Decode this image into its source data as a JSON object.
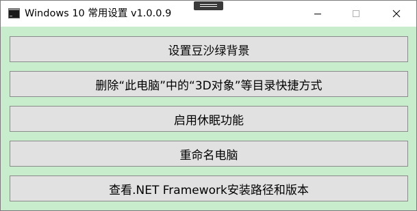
{
  "window": {
    "title": "Windows 10 常用设置 v1.0.0.9",
    "icon": "console-app-icon",
    "controls": {
      "minimize_icon": "minimize-icon",
      "maximize_icon": "maximize-icon",
      "close_icon": "close-icon"
    }
  },
  "colors": {
    "background": "#c7edcc",
    "button_face": "#e1e1e1",
    "button_border": "#8a8a8a"
  },
  "buttons": [
    {
      "label": "设置豆沙绿背景"
    },
    {
      "label": "删除“此电脑”中的“3D对象”等目录快捷方式"
    },
    {
      "label": "启用休眠功能"
    },
    {
      "label": "重命名电脑"
    },
    {
      "label": "查看.NET Framework安装路径和版本"
    }
  ]
}
